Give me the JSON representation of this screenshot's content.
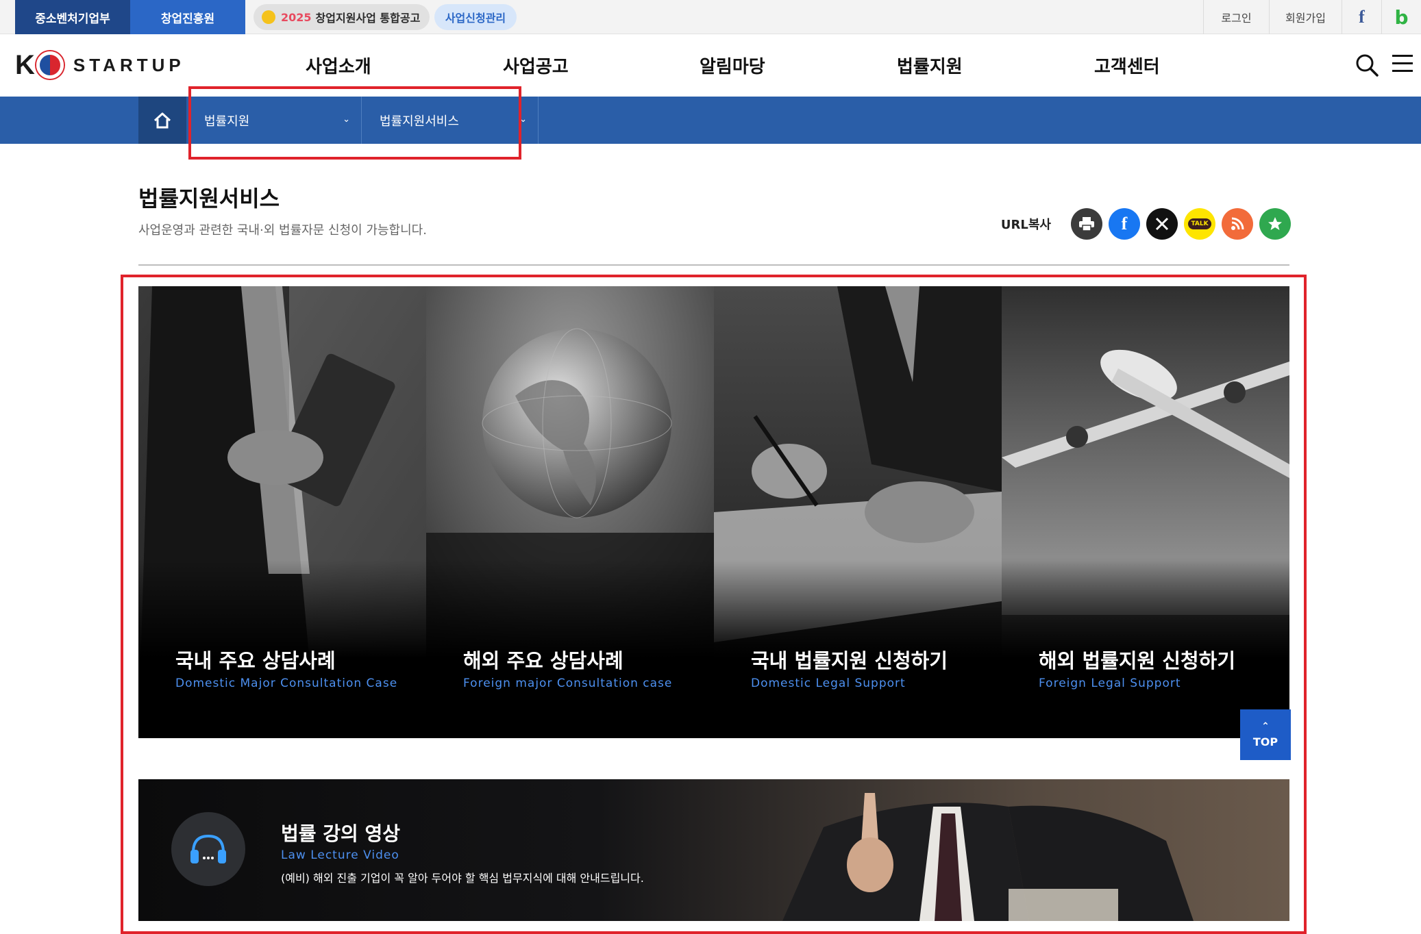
{
  "topbar": {
    "tab_ministry": "중소벤처기업부",
    "tab_agency": "창업진흥원",
    "notice_year": "2025",
    "notice_text": "창업지원사업 통합공고",
    "manage_label": "사업신청관리",
    "login": "로그인",
    "join": "회원가입",
    "facebook_glyph": "f",
    "blog_glyph": "b"
  },
  "header": {
    "logo_k": "K",
    "logo_text": "STARTUP",
    "nav": [
      "사업소개",
      "사업공고",
      "알림마당",
      "법률지원",
      "고객센터"
    ]
  },
  "location": {
    "depth1": "법률지원",
    "depth2": "법률지원서비스"
  },
  "page": {
    "title": "법률지원서비스",
    "description": "사업운영과 관련한 국내·외 법률자문 신청이 가능합니다.",
    "url_copy": "URL복사",
    "kakao_label": "TALK"
  },
  "cards": [
    {
      "title": "국내 주요 상담사례",
      "subtitle": "Domestic Major Consultation Case"
    },
    {
      "title": "해외 주요 상담사례",
      "subtitle": "Foreign major Consultation case"
    },
    {
      "title": "국내 법률지원 신청하기",
      "subtitle": "Domestic Legal Support"
    },
    {
      "title": "해외 법률지원 신청하기",
      "subtitle": "Foreign Legal Support"
    }
  ],
  "top_button": "TOP",
  "lecture": {
    "title": "법률 강의 영상",
    "subtitle": "Law Lecture Video",
    "description": "(예비) 해외 진출 기업이 꼭 알아 두어야 할 핵심 법무지식에 대해 안내드립니다."
  },
  "colors": {
    "primary_blue": "#2a5ea8",
    "accent_blue": "#4d90f0",
    "highlight_red": "#e0232b"
  }
}
